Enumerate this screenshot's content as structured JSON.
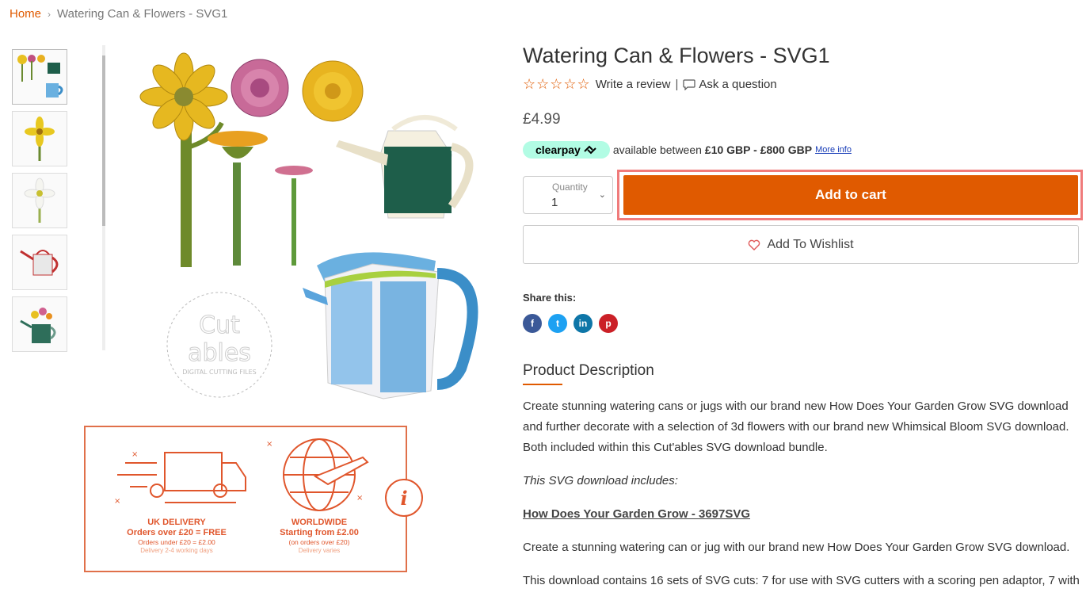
{
  "breadcrumb": {
    "home": "Home",
    "separator": "›",
    "current": "Watering Can & Flowers - SVG1"
  },
  "thumbnails": [
    "thumbnail-1",
    "thumbnail-2",
    "thumbnail-3",
    "thumbnail-4",
    "thumbnail-5"
  ],
  "main_image": {
    "watermark_top": "Cut",
    "watermark_bottom": "ables",
    "watermark_caption": "DIGITAL CUTTING FILES"
  },
  "delivery": {
    "uk_title": "UK DELIVERY",
    "uk_line1": "Orders over £20 = FREE",
    "uk_line2": "Orders under £20 = £2.00",
    "uk_line3": "Delivery 2-4 working days",
    "ww_title": "WORLDWIDE",
    "ww_line1": "Starting from £2.00",
    "ww_line2": "(on orders over £20)",
    "ww_line3": "Delivery varies",
    "info_icon": "i"
  },
  "product": {
    "title": "Watering Can & Flowers - SVG1",
    "stars": "☆☆☆☆☆",
    "write_review": "Write a review",
    "pipe": "|",
    "ask_question": "Ask a question",
    "price": "£4.99"
  },
  "clearpay": {
    "badge": "clearpay",
    "text": "available between",
    "range": "£10 GBP - £800 GBP",
    "more_info": "More info"
  },
  "quantity": {
    "label": "Quantity",
    "value": "1",
    "chevron": "⌄"
  },
  "add_to_cart": "Add to cart",
  "wishlist": "Add To Wishlist",
  "share": {
    "label": "Share this:",
    "facebook": "f",
    "twitter": "t",
    "linkedin": "in",
    "pinterest": "p"
  },
  "description": {
    "heading": "Product Description",
    "para1": "Create stunning watering cans or jugs with our brand new How Does Your Garden Grow SVG download and further decorate with a selection of 3d flowers with our brand new Whimsical Bloom SVG download. Both included within this Cut'ables SVG download bundle.",
    "para2": "This SVG download includes:",
    "para3": "How Does Your Garden Grow - 3697SVG",
    "para4": "Create a stunning watering can or jug with our brand new How Does Your Garden Grow SVG download.",
    "para5": "This download contains 16 sets of SVG cuts: 7 for use with SVG cutters with a scoring pen adaptor, 7 with"
  },
  "colors": {
    "accent": "#e05a00",
    "cta_outline": "#f07b7b",
    "clearpay": "#b2fce4",
    "delivery": "#e0562c"
  },
  "icons": {
    "star": "star-outline-icon",
    "ask": "speech-bubble-icon",
    "heart": "heart-outline-icon",
    "truck": "delivery-truck-icon",
    "globe": "globe-plane-icon",
    "info": "info-icon"
  }
}
